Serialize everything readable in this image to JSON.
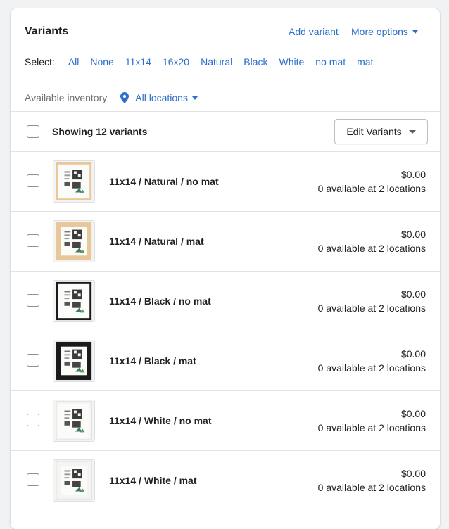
{
  "card": {
    "title": "Variants",
    "add_variant_label": "Add variant",
    "more_options_label": "More options"
  },
  "select": {
    "label": "Select:",
    "options": [
      "All",
      "None",
      "11x14",
      "16x20",
      "Natural",
      "Black",
      "White",
      "no mat",
      "mat"
    ]
  },
  "inventory": {
    "label": "Available inventory",
    "location_label": "All locations"
  },
  "list_header": {
    "showing_text": "Showing 12 variants",
    "edit_button_label": "Edit Variants"
  },
  "variants": [
    {
      "name": "11x14 / Natural / no mat",
      "price": "$0.00",
      "availability": "0 available at 2 locations",
      "frame": "natural",
      "mat": false
    },
    {
      "name": "11x14 / Natural / mat",
      "price": "$0.00",
      "availability": "0 available at 2 locations",
      "frame": "natural",
      "mat": true
    },
    {
      "name": "11x14 / Black / no mat",
      "price": "$0.00",
      "availability": "0 available at 2 locations",
      "frame": "black",
      "mat": false
    },
    {
      "name": "11x14 / Black / mat",
      "price": "$0.00",
      "availability": "0 available at 2 locations",
      "frame": "black",
      "mat": true
    },
    {
      "name": "11x14 / White / no mat",
      "price": "$0.00",
      "availability": "0 available at 2 locations",
      "frame": "white",
      "mat": false
    },
    {
      "name": "11x14 / White / mat",
      "price": "$0.00",
      "availability": "0 available at 2 locations",
      "frame": "white",
      "mat": true
    }
  ],
  "colors": {
    "link": "#2c6ecb",
    "text": "#202223",
    "subdued": "#6d7175",
    "frame_natural": "#e8c89a",
    "frame_black": "#1a1a1a",
    "frame_white": "#f4f4f2"
  }
}
